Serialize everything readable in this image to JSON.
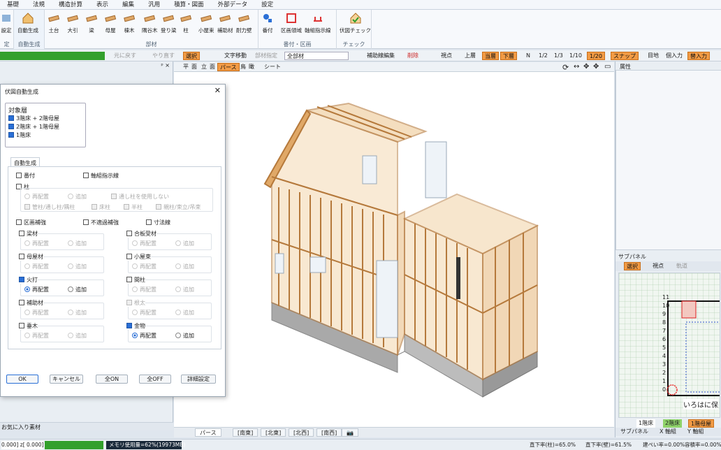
{
  "menu": [
    "基礎",
    "法規",
    "構造計算",
    "表示",
    "編集",
    "汎用",
    "積算・図面",
    "外部データ",
    "設定"
  ],
  "ribbon": {
    "groups": [
      {
        "label": "定",
        "buttons": [
          "設定"
        ]
      },
      {
        "label": "自動生成",
        "buttons": [
          "自動生成"
        ]
      },
      {
        "label": "部材",
        "buttons": [
          "土台",
          "大引",
          "梁",
          "母屋",
          "棟木",
          "隅谷木",
          "登り梁",
          "柱",
          "小屋束",
          "補助材",
          "耐力壁"
        ]
      },
      {
        "label": "番付・区画",
        "buttons": [
          "番付",
          "区画領域",
          "軸組指示線"
        ]
      },
      {
        "label": "チェック",
        "buttons": [
          "伏図チェック"
        ]
      }
    ]
  },
  "toolbar": {
    "undo": "元に戻す",
    "redo": "やり直す",
    "select": "選択",
    "text_move": "文字移動",
    "member_spec": "部材指定",
    "all_members": "全部材",
    "aux_edit": "補助線編集",
    "delete": "削除",
    "viewpoint": "視点",
    "upper_floor": "上層",
    "current_floor": "当層",
    "lower_floor": "下層",
    "n": "N",
    "half": "1/2",
    "third": "1/3",
    "tenth": "1/10",
    "scale": "1/20",
    "snap": "スナップ",
    "grid": "目地",
    "enter": "個入力",
    "replace": "替入力"
  },
  "left_panel": {
    "tabs": [
      "お気に入り",
      "素材"
    ],
    "pin": "ᵖ ×"
  },
  "dialog": {
    "title": "伏図自動生成",
    "target_title": "対象層",
    "targets": [
      {
        "label": "3階床 + 2階母屋",
        "checked": true
      },
      {
        "label": "2階床 + 1階母屋",
        "checked": true
      },
      {
        "label": "1階床",
        "checked": true
      }
    ],
    "tab": "自動生成",
    "banzuke": "番付",
    "axis_line": "軸組指示線",
    "pillar": "柱",
    "re_place": "再配置",
    "add": "追加",
    "use_through": "通し柱を使用しない",
    "pillar_kinds": [
      "管柱/通し柱/隅柱",
      "床柱",
      "半柱",
      "親柱/束立/吊束"
    ],
    "zone_reinforce": "区画補強",
    "unused_reinforce": "不適過補強",
    "dimension": "寸法線",
    "sections": [
      {
        "label": "梁材",
        "checked": false,
        "selected": 1
      },
      {
        "label": "合板受材",
        "checked": false,
        "selected": 1
      },
      {
        "label": "母屋材",
        "checked": false,
        "selected": 1
      },
      {
        "label": "小屋束",
        "checked": false,
        "selected": 1
      },
      {
        "label": "火打",
        "checked": true,
        "selected": 0
      },
      {
        "label": "間柱",
        "checked": false,
        "selected": 1
      },
      {
        "label": "補助材",
        "checked": false,
        "selected": 1
      },
      {
        "label": "根太",
        "checked": false,
        "selected": 0,
        "disabled": true
      },
      {
        "label": "垂木",
        "checked": false,
        "selected": 1
      },
      {
        "label": "金物",
        "checked": true,
        "selected": 0
      }
    ],
    "buttons": {
      "ok": "OK",
      "cancel": "キャンセル",
      "all_on": "全ON",
      "all_off": "全OFF",
      "detail": "詳細設定"
    }
  },
  "view": {
    "modes": [
      "平",
      "面",
      "立",
      "面",
      "パース",
      "鳥",
      "瞰",
      "シート"
    ],
    "tabs": [
      "パース",
      "[南東]",
      "[北東]",
      "[北西]",
      "[南西]"
    ]
  },
  "right_panel": {
    "property": "属性",
    "subpanel": "サブパネル",
    "subtools": [
      "選択",
      "視点",
      "軌道"
    ],
    "grid_rows": [
      "11",
      "10",
      "9",
      "8",
      "7",
      "6",
      "5",
      "4",
      "3",
      "2",
      "1",
      "0"
    ],
    "grid_cols": "いろはに保",
    "floors": [
      "1階床",
      "2階床",
      "1階母屋"
    ],
    "bottom_tabs": [
      "サブパネル",
      "X 軸組",
      "Y 軸組"
    ]
  },
  "status": {
    "coord": "0.000] z[ 0.000]",
    "memory": "メモリ使用量=62%(19973MB)",
    "pillar_ratio": "直下率(柱)=65.0%",
    "wall_ratio": "直下率(壁)=61.5%",
    "cover_ratio": "建ぺい率=0.00%",
    "volume_ratio": "容積率=0.00%"
  },
  "colors": {
    "accent": "#2a6fd6",
    "orange": "#f29b45",
    "green": "#33a02c",
    "wood": "#e0a867"
  }
}
